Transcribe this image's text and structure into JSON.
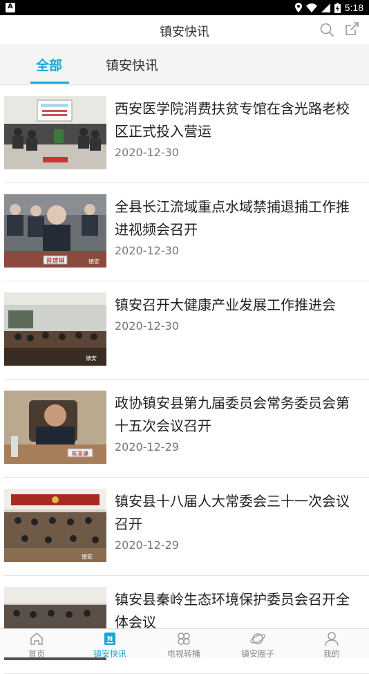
{
  "status_bar": {
    "time": "5:18",
    "notification_letter": "A"
  },
  "header": {
    "title": "镇安快讯"
  },
  "tabs": [
    {
      "label": "全部",
      "active": true
    },
    {
      "label": "镇安快讯",
      "active": false
    }
  ],
  "news": [
    {
      "title": "西安医学院消费扶贫专馆在含光路老校区正式投入营运",
      "date": "2020-12-30",
      "thumb_caption": ""
    },
    {
      "title": "全县长江流域重点水域禁捕退捕工作推进视频会召开",
      "date": "2020-12-30",
      "thumb_caption": "曾建琳"
    },
    {
      "title": "镇安召开大健康产业发展工作推进会",
      "date": "2020-12-30",
      "thumb_caption": ""
    },
    {
      "title": "政协镇安县第九届委员会常务委员会第十五次会议召开",
      "date": "2020-12-29",
      "thumb_caption": "陈圣健"
    },
    {
      "title": "镇安县十八届人大常委会三十一次会议召开",
      "date": "2020-12-29",
      "thumb_caption": ""
    },
    {
      "title": "镇安县秦岭生态环境保护委员会召开全体会议",
      "date": "",
      "thumb_caption": ""
    }
  ],
  "watermark": "镇安",
  "bottom_nav": [
    {
      "label": "首页",
      "icon": "home-icon",
      "active": false
    },
    {
      "label": "镇安快讯",
      "icon": "news-icon",
      "active": true
    },
    {
      "label": "电视转播",
      "icon": "tv-broadcast-icon",
      "active": false
    },
    {
      "label": "镇安圈子",
      "icon": "planet-icon",
      "active": false
    },
    {
      "label": "我的",
      "icon": "profile-icon",
      "active": false
    }
  ],
  "colors": {
    "accent": "#1aa6d8",
    "text": "#222222",
    "muted": "#777777"
  }
}
